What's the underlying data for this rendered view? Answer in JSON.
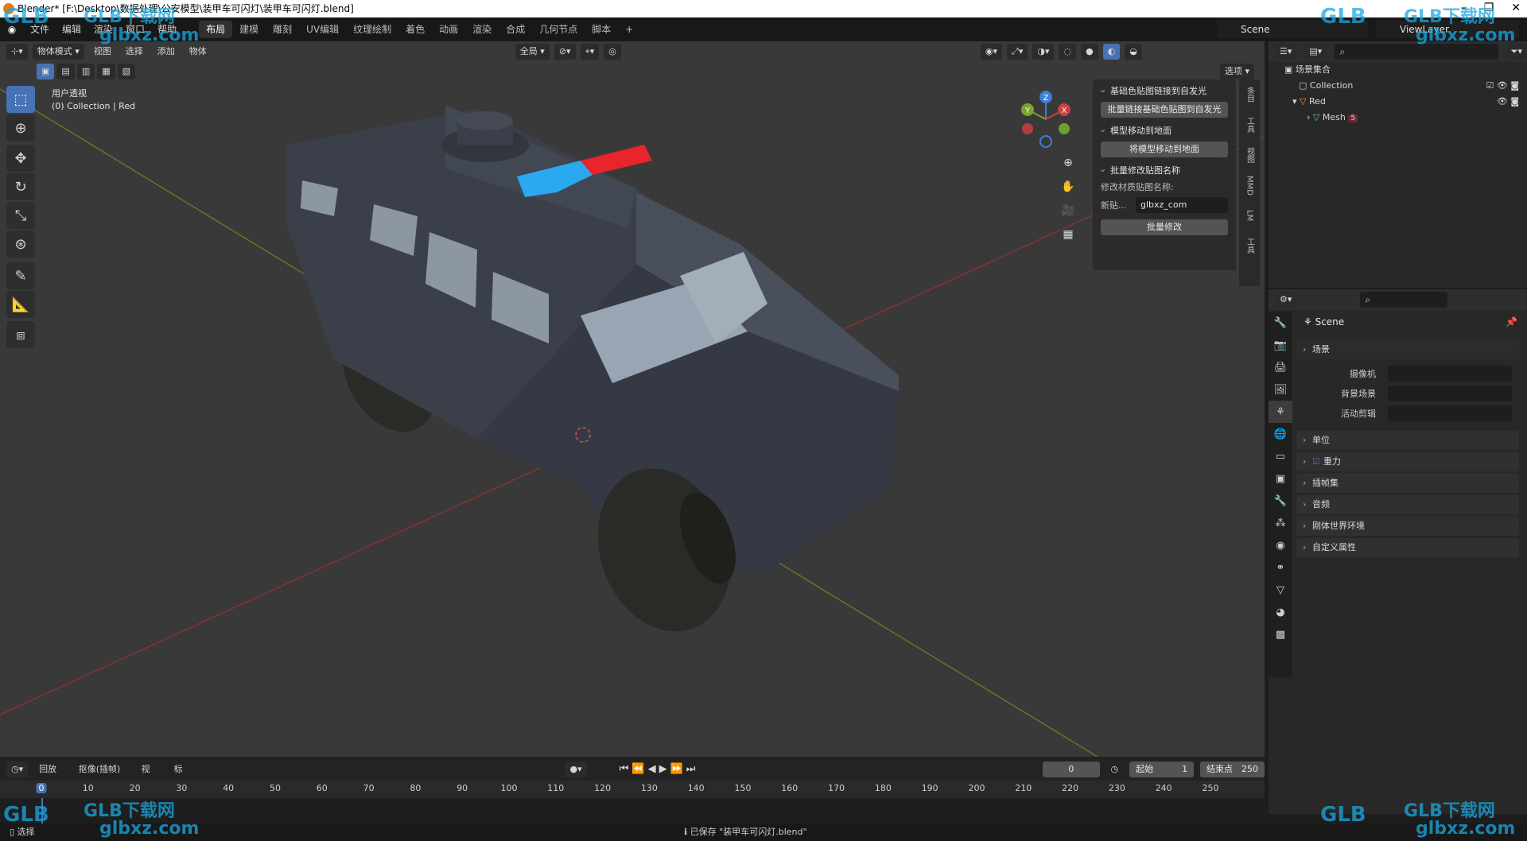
{
  "window": {
    "title": "Blender* [F:\\Desktop\\数据处理\\公安模型\\装甲车可闪灯\\装甲车可闪灯.blend]",
    "controls": [
      "–",
      "❐",
      "✕"
    ]
  },
  "menubar": {
    "items": [
      "文件",
      "编辑",
      "渲染",
      "窗口",
      "帮助"
    ],
    "workspaces": [
      "布局",
      "建模",
      "雕刻",
      "UV编辑",
      "纹理绘制",
      "着色",
      "动画",
      "渲染",
      "合成",
      "几何节点",
      "脚本"
    ],
    "active_workspace": "布局",
    "add_tab": "+",
    "scene": "Scene",
    "view_layer": "ViewLayer"
  },
  "viewport": {
    "header": {
      "mode": "物体模式",
      "menus": [
        "视图",
        "选择",
        "添加",
        "物体"
      ],
      "transform_orientation": "全局",
      "options": "选项"
    },
    "overlay_text": {
      "view_name": "用户透视",
      "collection_info": "(0) Collection | Red"
    },
    "tools": [
      "select-box",
      "cursor",
      "move",
      "rotate",
      "scale",
      "transform",
      "annotate",
      "measure",
      "add-cube"
    ],
    "gizmo_axes": {
      "x": "X",
      "y": "Y",
      "z": "Z"
    }
  },
  "npanel": {
    "sections": [
      {
        "title": "基础色贴图链接到自发光",
        "button": "批量链接基础色贴图到自发光"
      },
      {
        "title": "模型移动到地面",
        "button": "将模型移动到地面"
      },
      {
        "title": "批量修改贴图名称",
        "label": "修改材质贴图名称:",
        "field_label": "新贴...",
        "field_value": "glbxz_com",
        "button": "批量修改"
      }
    ],
    "tabs": [
      "条目",
      "工具",
      "视图",
      "MMD",
      "LM",
      "工具"
    ]
  },
  "outliner": {
    "root": "场景集合",
    "items": [
      {
        "name": "Collection",
        "level": 1
      },
      {
        "name": "Red",
        "level": 2
      },
      {
        "name": "Mesh",
        "level": 3,
        "badge": "5"
      }
    ]
  },
  "properties": {
    "context": "Scene",
    "scene_section": "场景",
    "rows": [
      {
        "label": "摄像机"
      },
      {
        "label": "背景场景"
      },
      {
        "label": "活动剪辑"
      }
    ],
    "sections": [
      "单位",
      "重力",
      "插帧集",
      "音频",
      "刚体世界环境",
      "自定义属性"
    ]
  },
  "timeline": {
    "menus": [
      "回放",
      "抠像(插帧)",
      "视图",
      "标记"
    ],
    "current_frame": "0",
    "start_label": "起始",
    "start": "1",
    "end_label": "结束点",
    "end": "250",
    "ticks": [
      "0",
      "10",
      "20",
      "30",
      "40",
      "50",
      "60",
      "70",
      "80",
      "90",
      "100",
      "110",
      "120",
      "130",
      "140",
      "150",
      "160",
      "170",
      "180",
      "190",
      "200",
      "210",
      "220",
      "230",
      "240",
      "250"
    ]
  },
  "statusbar": {
    "left": "选择",
    "message": "已保存 \"装甲车可闪灯.blend\""
  },
  "watermark": {
    "brand": "GLB下载网",
    "site": "glbxz.com",
    "logo": "GLB"
  },
  "colors": {
    "accent": "#4772b3",
    "viewport_bg": "#393939",
    "light_blue": "#2aa8f0",
    "light_red": "#e8242c",
    "x_axis": "#c9413f",
    "y_axis": "#7ba52b",
    "z_axis": "#3c7fd6"
  }
}
